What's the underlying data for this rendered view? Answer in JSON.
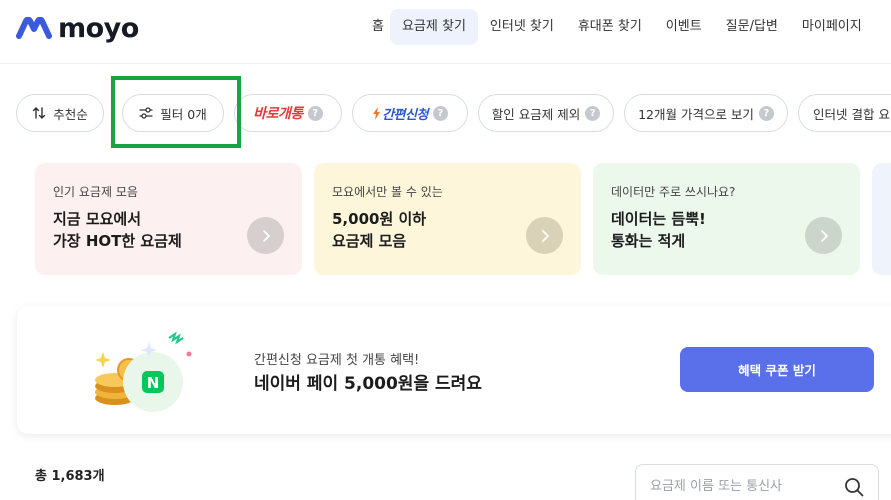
{
  "brand": {
    "name": "moyo",
    "color": "#3b5bdb"
  },
  "nav": {
    "items": [
      {
        "label": "홈"
      },
      {
        "label": "요금제 찾기",
        "active": true
      },
      {
        "label": "인터넷 찾기"
      },
      {
        "label": "휴대폰 찾기"
      },
      {
        "label": "이벤트"
      },
      {
        "label": "질문/답변"
      },
      {
        "label": "마이페이지"
      }
    ]
  },
  "chips": {
    "sort": "추천순",
    "filter": "필터 0개",
    "baro": "바로개통",
    "easy": "간편신청",
    "discount": "할인 요금제 제외",
    "month": "12개월 가격으로 보기",
    "internet": "인터넷 결합 요"
  },
  "cards": [
    {
      "sub": "인기 요금제 모음",
      "line1": "지금 모요에서",
      "line2": "가장 HOT한 요금제"
    },
    {
      "sub": "모요에서만 볼 수 있는",
      "line1": "5,000원 이하",
      "line2": "요금제 모음"
    },
    {
      "sub": "데이터만 주로 쓰시나요?",
      "line1": "데이터는 듬뿍!",
      "line2": "통화는 적게"
    }
  ],
  "banner": {
    "sub": "간편신청 요금제 첫 개통 혜택!",
    "main": "네이버 페이 5,000원을 드려요",
    "cta": "혜택 쿠폰 받기"
  },
  "total": "총 1,683개",
  "search": {
    "placeholder": "요금제 이름 또는 통신사"
  },
  "colors": {
    "accent": "#5a70ea",
    "highlight": "#1aa342",
    "baro": "#e23a3a",
    "easy": "#2d57c8"
  }
}
